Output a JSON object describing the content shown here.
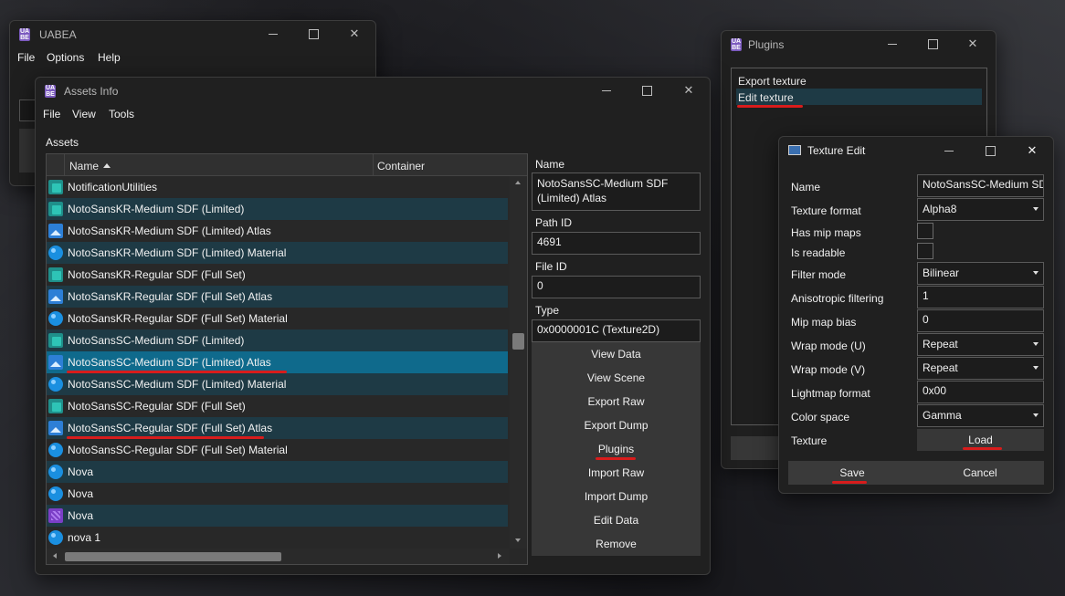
{
  "uabea": {
    "title": "UABEA",
    "menu": [
      "File",
      "Options",
      "Help"
    ]
  },
  "assets_info": {
    "title": "Assets Info",
    "menu": [
      "File",
      "View",
      "Tools"
    ],
    "assets_label": "Assets",
    "columns": {
      "name": "Name",
      "container": "Container"
    },
    "rows": [
      {
        "label": "NotificationUtilities",
        "icon": "monobehaviour-icon"
      },
      {
        "label": "NotoSansKR-Medium SDF (Limited)",
        "icon": "monobehaviour-icon"
      },
      {
        "label": "NotoSansKR-Medium SDF (Limited) Atlas",
        "icon": "texture-icon"
      },
      {
        "label": "NotoSansKR-Medium SDF (Limited) Material",
        "icon": "material-icon"
      },
      {
        "label": "NotoSansKR-Regular SDF (Full Set)",
        "icon": "monobehaviour-icon"
      },
      {
        "label": "NotoSansKR-Regular SDF (Full Set) Atlas",
        "icon": "texture-icon"
      },
      {
        "label": "NotoSansKR-Regular SDF (Full Set) Material",
        "icon": "material-icon"
      },
      {
        "label": "NotoSansSC-Medium SDF (Limited)",
        "icon": "monobehaviour-icon"
      },
      {
        "label": "NotoSansSC-Medium SDF (Limited) Atlas",
        "icon": "texture-icon"
      },
      {
        "label": "NotoSansSC-Medium SDF (Limited) Material",
        "icon": "material-icon"
      },
      {
        "label": "NotoSansSC-Regular SDF (Full Set)",
        "icon": "monobehaviour-icon"
      },
      {
        "label": "NotoSansSC-Regular SDF (Full Set) Atlas",
        "icon": "texture-icon"
      },
      {
        "label": "NotoSansSC-Regular SDF (Full Set) Material",
        "icon": "material-icon"
      },
      {
        "label": "Nova",
        "icon": "material-icon"
      },
      {
        "label": "Nova",
        "icon": "material-icon"
      },
      {
        "label": "Nova",
        "icon": "sprite-icon"
      },
      {
        "label": "nova 1",
        "icon": "material-icon"
      }
    ],
    "selected_row": 8,
    "fields": {
      "name_label": "Name",
      "name_value": "NotoSansSC-Medium SDF (Limited) Atlas",
      "path_id_label": "Path ID",
      "path_id_value": "4691",
      "file_id_label": "File ID",
      "file_id_value": "0",
      "type_label": "Type",
      "type_value": "0x0000001C (Texture2D)"
    },
    "actions": [
      "View Data",
      "View Scene",
      "Export Raw",
      "Export Dump",
      "Plugins",
      "Import Raw",
      "Import Dump",
      "Edit Data",
      "Remove"
    ]
  },
  "plugins": {
    "title": "Plugins",
    "items": [
      "Export texture",
      "Edit texture"
    ]
  },
  "texture_edit": {
    "title": "Texture Edit",
    "name_label": "Name",
    "name_value": "NotoSansSC-Medium SDF",
    "texture_format_label": "Texture format",
    "texture_format_value": "Alpha8",
    "has_mip_maps_label": "Has mip maps",
    "is_readable_label": "Is readable",
    "filter_mode_label": "Filter mode",
    "filter_mode_value": "Bilinear",
    "aniso_label": "Anisotropic filtering",
    "aniso_value": "1",
    "mip_bias_label": "Mip map bias",
    "mip_bias_value": "0",
    "wrap_u_label": "Wrap mode (U)",
    "wrap_u_value": "Repeat",
    "wrap_v_label": "Wrap mode (V)",
    "wrap_v_value": "Repeat",
    "lightmap_label": "Lightmap format",
    "lightmap_value": "0x00",
    "color_space_label": "Color space",
    "color_space_value": "Gamma",
    "texture_label": "Texture",
    "load_label": "Load",
    "save_label": "Save",
    "cancel_label": "Cancel"
  },
  "colors": {
    "accent_selected": "#0f6a8c",
    "row_alt": "#1e3a45",
    "annotation_red": "#d81c1c"
  }
}
